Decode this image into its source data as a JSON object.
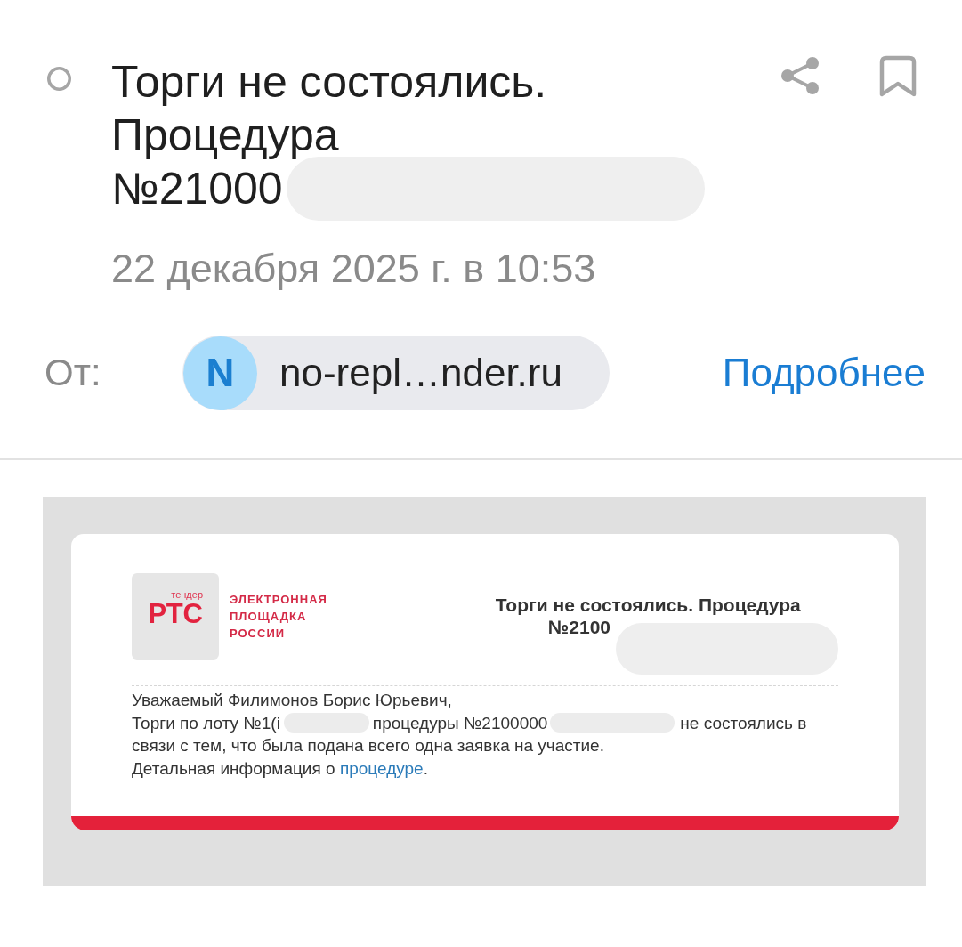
{
  "message": {
    "read": true,
    "title_lines": [
      [
        {
          "kind": "text",
          "text": "Торги не состоялись."
        }
      ],
      [
        {
          "kind": "text",
          "text": "Процедура"
        }
      ],
      [
        {
          "kind": "text",
          "text": "№21000"
        },
        {
          "kind": "redaction"
        }
      ]
    ],
    "bookmarked": false,
    "date": "22 декабря 2025 г. в 10:53"
  },
  "sender": {
    "label": "От:",
    "avatar_letter": "N",
    "address": "no-repl…nder.ru",
    "details_link": "Подробнее"
  },
  "email_body": {
    "logo": {
      "small_text": "тендер",
      "mark": "РТС",
      "caption_lines": [
        "ЭЛЕКТРОННАЯ",
        "ПЛОЩАДКА",
        "РОССИИ"
      ]
    },
    "title_lines": [
      [
        {
          "kind": "text",
          "text": "Торги не состоялись. Процедура"
        }
      ],
      [
        {
          "kind": "text",
          "text": "№2100"
        },
        {
          "kind": "redaction"
        }
      ]
    ],
    "lines": [
      [
        {
          "kind": "text",
          "text": "Уважаемый Филимонов Борис Юрьевич,"
        }
      ],
      [
        {
          "kind": "text",
          "text": "Торги по лоту №1(i"
        },
        {
          "kind": "redaction"
        },
        {
          "kind": "text",
          "text": "процедуры №2100000"
        },
        {
          "kind": "redaction"
        },
        {
          "kind": "text",
          "text": "не состоялись в"
        }
      ],
      [
        {
          "kind": "text",
          "text": "связи с тем, что была подана всего одна заявка на участие."
        }
      ],
      [
        {
          "kind": "text",
          "text": "Детальная информация о "
        },
        {
          "kind": "link",
          "text": "процедуре"
        },
        {
          "kind": "text",
          "text": "."
        }
      ]
    ]
  }
}
